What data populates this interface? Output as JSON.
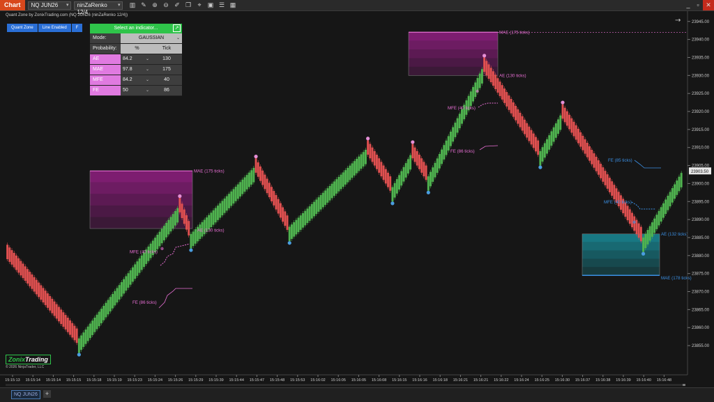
{
  "topbar": {
    "chart_tab": "Chart",
    "instrument": "NQ JUN26",
    "bar_type": "ninZaRenko 12/4",
    "tool_icons": [
      "bars-icon",
      "pencil-icon",
      "zoom-in-icon",
      "zoom-out-icon",
      "draw-icon",
      "copy-icon",
      "crosshair-icon",
      "screenshot-icon",
      "properties-icon",
      "data-box-icon"
    ],
    "window_controls": [
      "_",
      "▫",
      "✕"
    ]
  },
  "chart_info": "Quant Zone by ZonixTrading.com (NQ JUN26 (ninZaRenko 12/4))",
  "qz_buttons": [
    "Quant Zone",
    "Line Enabled",
    "F"
  ],
  "panel": {
    "select_label": "Select an indicator...",
    "mode_label": "Mode:",
    "mode_value": "GAUSSIAN",
    "probability_label": "Probability:",
    "pct_header": "%",
    "tick_header": "Tick",
    "rows": [
      {
        "name": "AE",
        "pct": "84.2",
        "tick": "130"
      },
      {
        "name": "MAE",
        "pct": "97.8",
        "tick": "175"
      },
      {
        "name": "MFE",
        "pct": "84.2",
        "tick": "40"
      },
      {
        "name": "FE",
        "pct": "50",
        "tick": "86"
      }
    ]
  },
  "price_axis": {
    "labels": [
      "23945.00",
      "23940.00",
      "23935.00",
      "23930.00",
      "23925.00",
      "23920.00",
      "23915.00",
      "23910.00",
      "23905.00",
      "23900.00",
      "23895.00",
      "23890.00",
      "23885.00",
      "23880.00",
      "23875.00",
      "23870.00",
      "23865.00",
      "23860.00",
      "23855.00"
    ],
    "current_price": "23903.50",
    "price_min": 23852.5,
    "price_max": 23946.5
  },
  "time_axis": [
    "15:15:13",
    "15:15:14",
    "15:15:14",
    "15:15:15",
    "15:15:18",
    "15:15:19",
    "15:15:23",
    "15:15:24",
    "15:15:26",
    "15:15:29",
    "15:15:39",
    "15:15:44",
    "15:15:47",
    "15:15:48",
    "15:15:53",
    "15:16:02",
    "15:16:05",
    "15:16:05",
    "15:16:08",
    "15:16:15",
    "15:16:16",
    "15:16:18",
    "15:16:21",
    "15:16:21",
    "15:16:22",
    "15:16:24",
    "15:16:25",
    "15:16:30",
    "15:16:37",
    "15:16:38",
    "15:16:39",
    "15:16:40",
    "15:16:48"
  ],
  "zone_labels": {
    "z1_mae": "MAE (175 ticks)",
    "z1_ae": "AE (130 ticks)",
    "z1_mfe": "MFE (40 ticks)",
    "z1_fe": "FE (86 ticks)",
    "z2_mae": "MAE (175 ticks)",
    "z2_ae": "AE (130 ticks)",
    "z2_mfe": "MFE (40 ticks)",
    "z2_fe": "FE (86 ticks)",
    "z3_ae": "AE (132 ticks)",
    "z3_mae": "MAE (178 ticks)",
    "z3_mfe": "MFE (40 ticks)",
    "z3_fe": "FE (85 ticks)"
  },
  "pivots": [
    {
      "bar": 0,
      "price": 23880
    },
    {
      "bar": 32,
      "price": 23856
    },
    {
      "bar": 77,
      "price": 23893
    },
    {
      "bar": 82,
      "price": 23885
    },
    {
      "bar": 111,
      "price": 23904
    },
    {
      "bar": 126,
      "price": 23887
    },
    {
      "bar": 161,
      "price": 23909
    },
    {
      "bar": 172,
      "price": 23898
    },
    {
      "bar": 181,
      "price": 23908
    },
    {
      "bar": 188,
      "price": 23901
    },
    {
      "bar": 213,
      "price": 23932
    },
    {
      "bar": 238,
      "price": 23908
    },
    {
      "bar": 248,
      "price": 23919
    },
    {
      "bar": 284,
      "price": 23884
    },
    {
      "bar": 302,
      "price": 23903
    }
  ],
  "logo": {
    "part1": "Zonix",
    "part2": "Trading"
  },
  "copyright": "© 2026 NinjaTrader, LLC",
  "bottom_tab": "NQ JUN26",
  "colors": {
    "up": "#4fb34f",
    "down": "#e05050",
    "magenta": "#e040d0",
    "cyan": "#2a8ad8",
    "accent": "#d8481c"
  }
}
